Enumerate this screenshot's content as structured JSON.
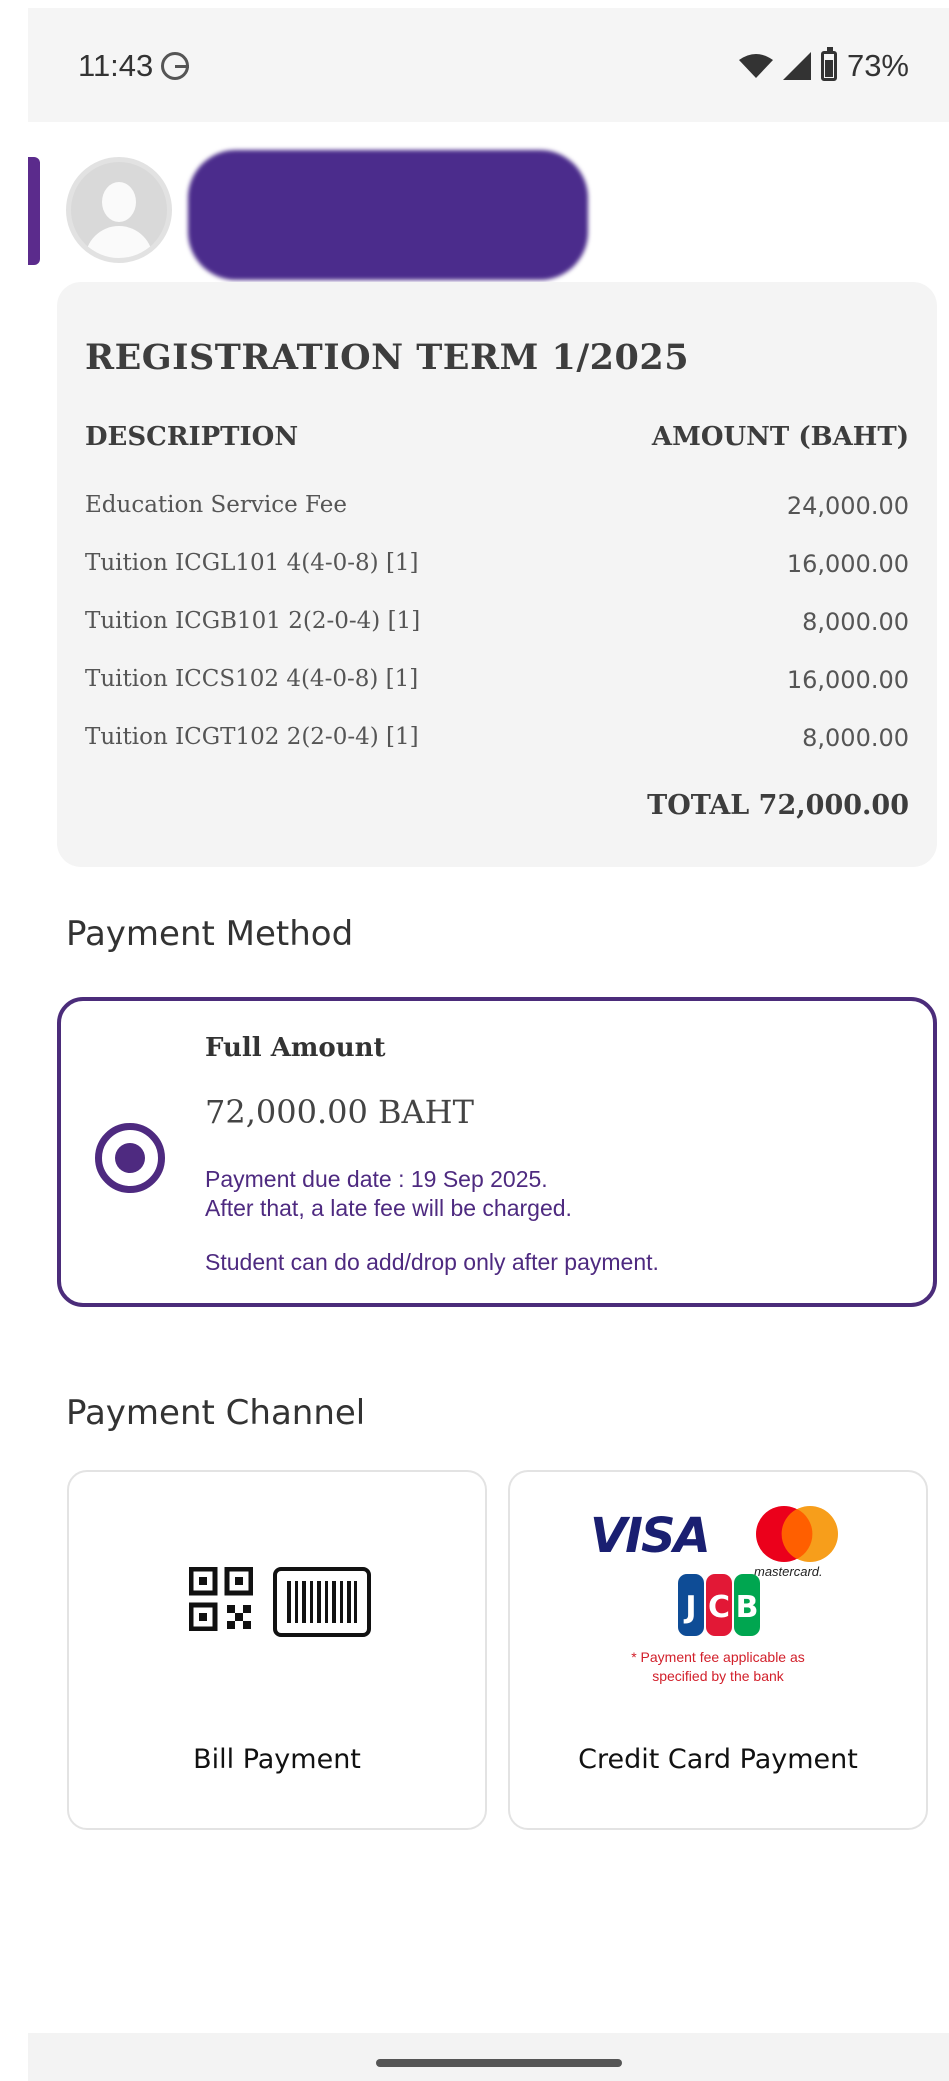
{
  "status_bar": {
    "time": "11:43",
    "battery": "73%",
    "icons": [
      "google-icon",
      "wifi-icon",
      "signal-icon",
      "battery-icon"
    ]
  },
  "profile": {
    "avatar": "default-user-avatar",
    "name": ""
  },
  "registration": {
    "title": "REGISTRATION TERM 1/2025",
    "columns": [
      "DESCRIPTION",
      "AMOUNT (BAHT)"
    ],
    "rows": [
      {
        "description": "Education Service Fee",
        "amount": "24,000.00"
      },
      {
        "description": "Tuition ICGL101 4(4-0-8) [1]",
        "amount": "16,000.00"
      },
      {
        "description": "Tuition ICGB101 2(2-0-4) [1]",
        "amount": "8,000.00"
      },
      {
        "description": "Tuition ICCS102 4(4-0-8) [1]",
        "amount": "16,000.00"
      },
      {
        "description": "Tuition ICGT102 2(2-0-4) [1]",
        "amount": "8,000.00"
      }
    ],
    "total": "TOTAL 72,000.00"
  },
  "payment_method": {
    "section_title": "Payment Method",
    "option": {
      "title": "Full Amount",
      "amount": "72,000.00 BAHT",
      "due_line1": "Payment due date : 19 Sep 2025.",
      "due_line2": "After that, a late fee will be charged.",
      "note": "Student can do add/drop only after payment.",
      "selected": true
    }
  },
  "payment_channel": {
    "section_title": "Payment Channel",
    "bill": {
      "label": "Bill Payment"
    },
    "credit": {
      "label": "Credit Card Payment",
      "visa": "VISA",
      "mastercard": "mastercard.",
      "fee_note_line1": "* Payment fee applicable as",
      "fee_note_line2": "specified by the bank"
    }
  },
  "colors": {
    "accent": "#4e2a80",
    "card_bg": "#f4f4f4",
    "fee_note": "#d21f2a"
  }
}
